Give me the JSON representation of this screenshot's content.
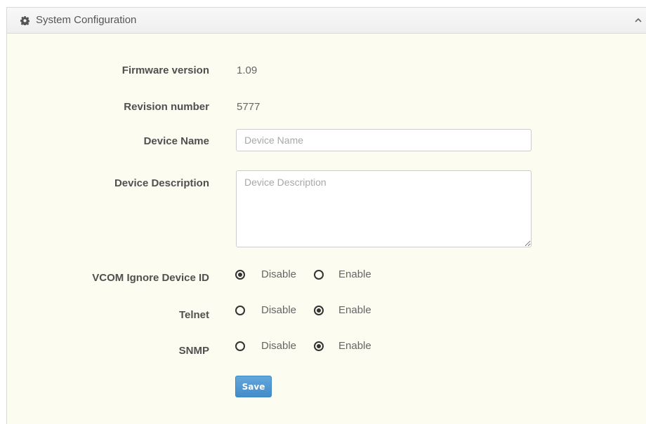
{
  "panel": {
    "title": "System Configuration",
    "header_icon": "gear-icon",
    "collapse_icon": "chevron-up-icon"
  },
  "fields": {
    "firmware": {
      "label": "Firmware version",
      "value": "1.09"
    },
    "revision": {
      "label": "Revision number",
      "value": "5777"
    },
    "device_name": {
      "label": "Device Name",
      "placeholder": "Device Name",
      "value": ""
    },
    "device_description": {
      "label": "Device Description",
      "placeholder": "Device Description",
      "value": ""
    }
  },
  "radios": {
    "vcom": {
      "label": "VCOM Ignore Device ID",
      "options": [
        "Disable",
        "Enable"
      ],
      "selected": "Disable"
    },
    "telnet": {
      "label": "Telnet",
      "options": [
        "Disable",
        "Enable"
      ],
      "selected": "Enable"
    },
    "snmp": {
      "label": "SNMP",
      "options": [
        "Disable",
        "Enable"
      ],
      "selected": "Enable"
    }
  },
  "actions": {
    "save_label": "Save"
  },
  "colors": {
    "accent": "#428bca",
    "panel_bg": "#fcfcf0",
    "header_bg": "#f4f4f4"
  }
}
